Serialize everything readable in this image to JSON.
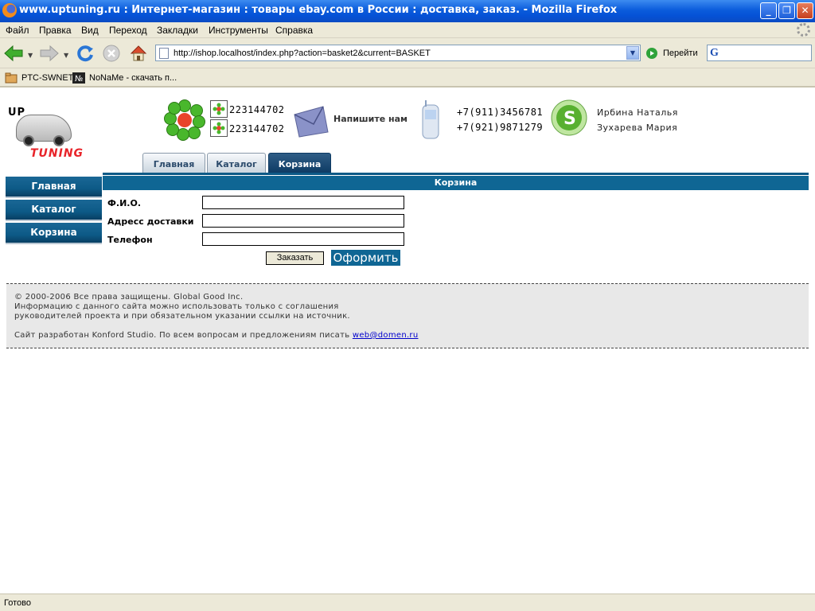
{
  "window": {
    "title": "www.uptuning.ru : Интернет-магазин : товары ebay.com в России : доставка, заказ. - Mozilla Firefox",
    "minimize_label": "_",
    "maximize_label": "❐",
    "close_label": "✕"
  },
  "menu": [
    "Файл",
    "Правка",
    "Вид",
    "Переход",
    "Закладки",
    "Инструменты",
    "Справка"
  ],
  "navigation": {
    "url": "http://ishop.localhost/index.php?action=basket2&current=BASKET",
    "go_label": "Перейти",
    "search_value": ""
  },
  "bookmarks": [
    "PTC-SWNET",
    "NoNaMe - скачать п..."
  ],
  "header": {
    "icq_numbers": [
      "223144702",
      "223144702"
    ],
    "write_us": "Напишите нам",
    "phones": [
      "+7(911)3456781",
      "+7(921)9871279"
    ],
    "contacts": [
      "Ирбина Наталья",
      "Зухарева Мария"
    ],
    "logo_top": "UP",
    "logo_bottom": "TUNING"
  },
  "tabs": [
    "Главная",
    "Каталог",
    "Корзина"
  ],
  "active_tab": "Корзина",
  "sidebar": [
    "Главная",
    "Каталог",
    "Корзина"
  ],
  "cart": {
    "title": "Корзина",
    "fields": [
      {
        "label": "Ф.И.О.",
        "value": ""
      },
      {
        "label": "Адресс доставки",
        "value": ""
      },
      {
        "label": "Телефон",
        "value": ""
      }
    ],
    "order_button": "Заказать",
    "checkout_button": "Оформить"
  },
  "footer": {
    "line1": "© 2000-2006 Все права защищены. Global Good Inc.",
    "line2": "Информацию с данного сайта можно использовать только с соглашения",
    "line3": "руководителей проекта и при обязательном указании ссылки на источник.",
    "line4_text": "Сайт разработан Konford Studio. По всем вопросам и предложениям писать ",
    "email": "web@domen.ru"
  },
  "status": "Готово",
  "colors": {
    "accent": "#0f6694",
    "titlebar": "#0b5cdc",
    "chrome": "#ece9d8",
    "logo_red": "#e8242a"
  }
}
